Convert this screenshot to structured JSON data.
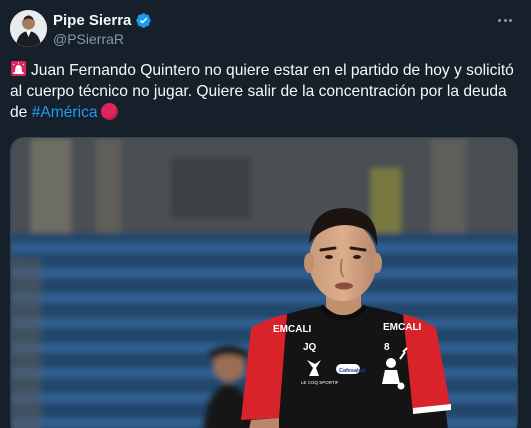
{
  "author": {
    "display_name": "Pipe Sierra",
    "handle": "@PSierraR",
    "avatar_icon": "user-avatar",
    "verified_icon": "verified-badge-icon"
  },
  "tweet": {
    "text_before_hashtag": "Juan Fernando Quintero no quiere estar en el partido de hoy y solicitó al cuerpo técnico no jugar. Quiere salir de la concentración por la deuda de ",
    "hashtag": "#América",
    "leading_emoji": "siren-emoji",
    "trailing_emoji": "red-circle-emoji"
  },
  "menu": {
    "icon": "more-options-icon"
  },
  "media": {
    "kind": "photo",
    "jersey_left_sponsor": "EMCALI",
    "jersey_right_sponsor": "EMCALI",
    "jersey_initials": "JQ",
    "jersey_number": "8",
    "jersey_center_badge": "Cafesalud",
    "jersey_brand": "LE COQ SPORTIF"
  },
  "colors": {
    "background": "#15202b",
    "text": "#f7f9f9",
    "secondary_text": "#8b98a5",
    "link": "#1d9bf0",
    "verified": "#1d9bf0",
    "red_circle": "#e0245e"
  }
}
